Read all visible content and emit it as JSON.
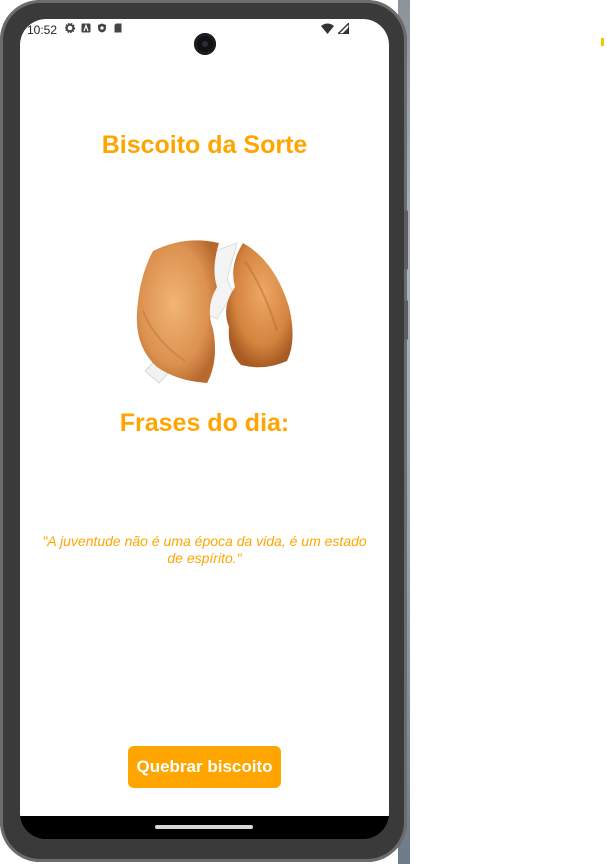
{
  "status_bar": {
    "time": "10:52",
    "left_icons": [
      "gear-icon",
      "a-icon",
      "shield-icon",
      "sd-card-icon"
    ],
    "right_icons": [
      "wifi-icon",
      "signal-icon"
    ]
  },
  "app": {
    "title": "Biscoito da Sorte",
    "image": "fortune-cookie",
    "subtitle": "Frases do dia:",
    "phrase": "\"A juventude não é uma época da vida, é um estado de espírito.\"",
    "button_label": "Quebrar biscoito"
  },
  "colors": {
    "accent": "#FFA500",
    "background": "#FFFFFF",
    "button_text": "#FFFFFF"
  }
}
